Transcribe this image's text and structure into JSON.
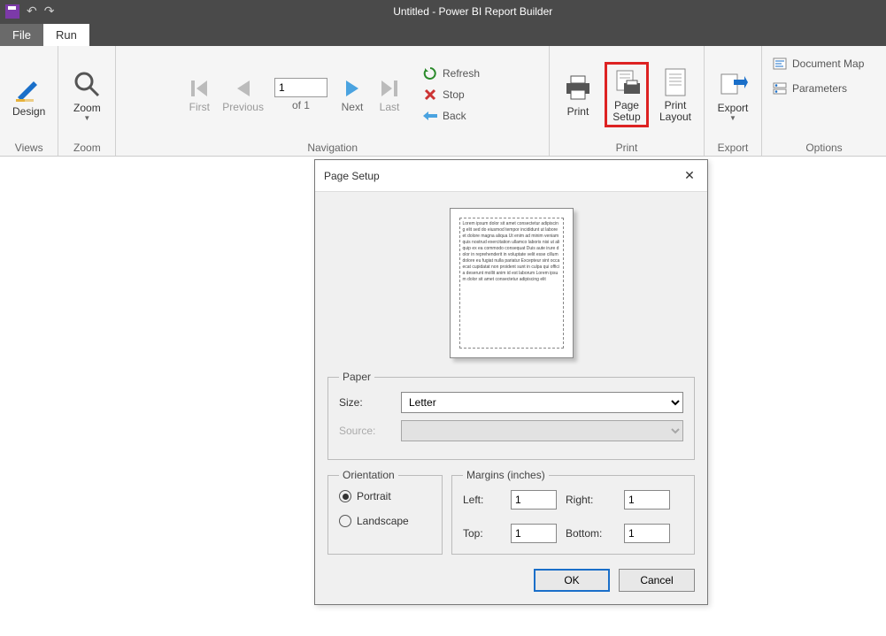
{
  "title": "Untitled - Power BI Report Builder",
  "tabs": {
    "file": "File",
    "run": "Run"
  },
  "ribbon": {
    "views": {
      "label": "Views",
      "design": "Design"
    },
    "zoom": {
      "label": "Zoom",
      "zoom": "Zoom"
    },
    "navigation": {
      "label": "Navigation",
      "first": "First",
      "previous": "Previous",
      "page_value": "1",
      "page_of": "of  1",
      "next": "Next",
      "last": "Last",
      "refresh": "Refresh",
      "stop": "Stop",
      "back": "Back"
    },
    "print": {
      "label": "Print",
      "print": "Print",
      "page_setup": "Page\nSetup",
      "print_layout": "Print\nLayout"
    },
    "export": {
      "label": "Export",
      "export": "Export"
    },
    "options": {
      "label": "Options",
      "doc_map": "Document Map",
      "parameters": "Parameters"
    }
  },
  "dialog": {
    "title": "Page Setup",
    "paper": {
      "legend": "Paper",
      "size_label": "Size:",
      "size_value": "Letter",
      "source_label": "Source:"
    },
    "orientation": {
      "legend": "Orientation",
      "portrait": "Portrait",
      "landscape": "Landscape",
      "selected": "portrait"
    },
    "margins": {
      "legend": "Margins (inches)",
      "left_label": "Left:",
      "left_value": "1",
      "right_label": "Right:",
      "right_value": "1",
      "top_label": "Top:",
      "top_value": "1",
      "bottom_label": "Bottom:",
      "bottom_value": "1"
    },
    "ok": "OK",
    "cancel": "Cancel"
  }
}
